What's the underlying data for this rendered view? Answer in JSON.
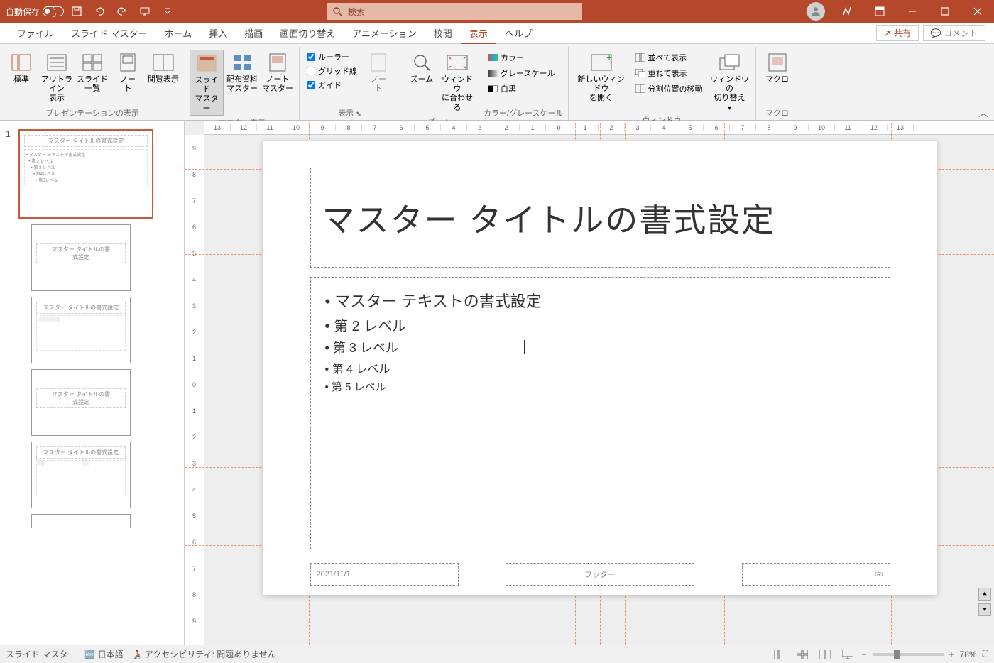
{
  "titlebar": {
    "autosave_label": "自動保存",
    "autosave_state": "オフ",
    "search_placeholder": "検索"
  },
  "tabs": {
    "file": "ファイル",
    "slide_master": "スライド マスター",
    "home": "ホーム",
    "insert": "挿入",
    "draw": "描画",
    "transitions": "画面切り替え",
    "animations": "アニメーション",
    "review": "校閲",
    "view": "表示",
    "help": "ヘルプ",
    "share": "共有",
    "comment": "コメント"
  },
  "ribbon": {
    "groups": {
      "presentation_views": "プレゼンテーションの表示",
      "master_views": "マスター表示",
      "show": "表示",
      "zoom": "ズーム",
      "color_grayscale": "カラー/グレースケール",
      "window": "ウィンドウ",
      "macros": "マクロ"
    },
    "btns": {
      "normal": "標準",
      "outline": "アウトライン\n表示",
      "slide_sorter": "スライド\n一覧",
      "notes_page": "ノー\nト",
      "reading_view": "閲覧表示",
      "slide_master": "スライド\nマスター",
      "handout_master": "配布資料\nマスター",
      "notes_master": "ノート\nマスター",
      "ruler": "ルーラー",
      "gridlines": "グリッド線",
      "guides": "ガイド",
      "notes": "ノー\nト",
      "zoom": "ズーム",
      "fit_window": "ウィンドウ\nに合わせる",
      "color": "カラー",
      "grayscale": "グレースケール",
      "bw": "白黒",
      "new_window": "新しいウィンドウ\nを開く",
      "arrange_all": "並べて表示",
      "cascade": "重ねて表示",
      "move_split": "分割位置の移動",
      "switch_windows": "ウィンドウの\n切り替え",
      "macros": "マクロ"
    }
  },
  "slide": {
    "title": "マスター タイトルの書式設定",
    "level1": "マスター テキストの書式設定",
    "level2": "第 2 レベル",
    "level3": "第 3 レベル",
    "level4": "第 4 レベル",
    "level5": "第 5 レベル",
    "date": "2021/11/1",
    "footer": "フッター",
    "slidenum": "‹#›"
  },
  "thumbs": {
    "master_title": "マスター タイトルの書式設定",
    "master_text": "マスター テキストの書式設定",
    "layout_title": "マスター タイトルの書\n式設定"
  },
  "statusbar": {
    "mode": "スライド マスター",
    "language": "日本語",
    "accessibility": "アクセシビリティ: 問題ありません",
    "zoom": "78%"
  },
  "ruler_ticks": [
    "13",
    "12",
    "11",
    "10",
    "9",
    "8",
    "7",
    "6",
    "5",
    "4",
    "3",
    "2",
    "1",
    "0",
    "1",
    "2",
    "3",
    "4",
    "5",
    "6",
    "7",
    "8",
    "9",
    "10",
    "11",
    "12",
    "13"
  ],
  "ruler_v_ticks": [
    "9",
    "8",
    "7",
    "6",
    "5",
    "4",
    "3",
    "2",
    "1",
    "0",
    "1",
    "2",
    "3",
    "4",
    "5",
    "6",
    "7",
    "8",
    "9"
  ]
}
